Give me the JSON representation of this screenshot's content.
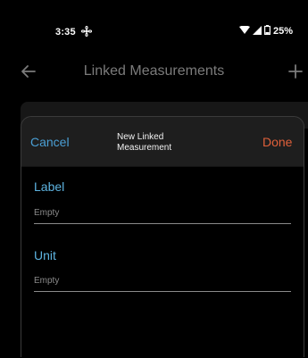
{
  "status_bar": {
    "time": "3:35",
    "battery": "25%",
    "icons": [
      "fan-icon",
      "wifi-icon",
      "signal-icon",
      "battery-icon"
    ]
  },
  "app_bar": {
    "title": "Linked Measurements",
    "back_icon": "back-arrow-icon",
    "add_icon": "plus-icon"
  },
  "dialog": {
    "cancel_label": "Cancel",
    "title": "New Linked Measurement",
    "done_label": "Done",
    "fields": [
      {
        "label": "Label",
        "value": "",
        "placeholder": "Empty"
      },
      {
        "label": "Unit",
        "value": "",
        "placeholder": "Empty"
      }
    ]
  },
  "colors": {
    "accent_blue": "#4a9fd5",
    "field_label_blue": "#5db3e0",
    "done_orange": "#e0603a",
    "background": "#000000",
    "sheet_header": "#1e1e1e"
  }
}
